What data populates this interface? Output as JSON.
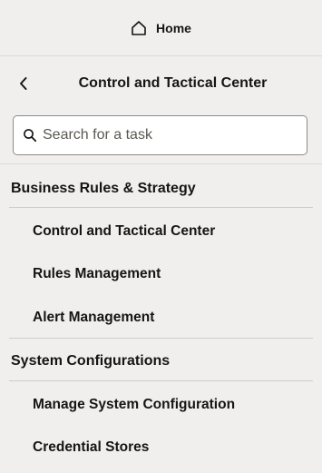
{
  "home": {
    "label": "Home",
    "icon": "home-icon"
  },
  "header": {
    "title": "Control and Tactical Center",
    "back_icon": "chevron-left-icon"
  },
  "search": {
    "placeholder": "Search for a task",
    "value": "",
    "icon": "search-icon"
  },
  "sections": [
    {
      "title": "Business Rules & Strategy",
      "items": [
        {
          "label": "Control and Tactical Center"
        },
        {
          "label": "Rules Management"
        },
        {
          "label": "Alert Management"
        }
      ]
    },
    {
      "title": "System Configurations",
      "items": [
        {
          "label": "Manage System Configuration"
        },
        {
          "label": "Credential Stores"
        }
      ]
    }
  ],
  "colors": {
    "background": "#f1efed",
    "text": "#161513",
    "divider": "#dcd9d5",
    "search_border": "#8e8b86"
  }
}
